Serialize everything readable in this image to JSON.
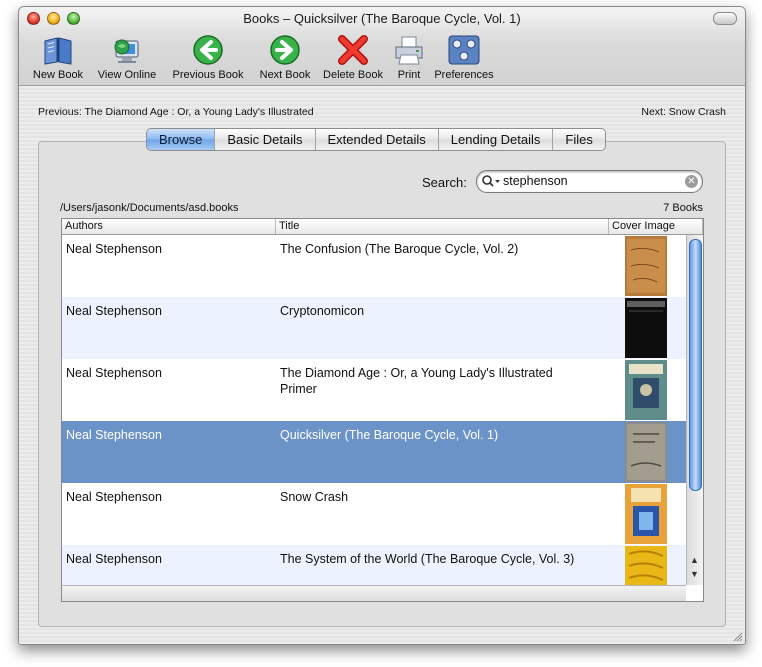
{
  "window": {
    "title": "Books – Quicksilver (The Baroque Cycle, Vol. 1)"
  },
  "toolbar": {
    "new_book": "New Book",
    "view_online": "View Online",
    "previous_book": "Previous Book",
    "next_book": "Next Book",
    "delete_book": "Delete Book",
    "print": "Print",
    "preferences": "Preferences"
  },
  "nav": {
    "previous": "Previous: The Diamond Age : Or, a Young Lady's Illustrated",
    "next": "Next: Snow Crash"
  },
  "tabs": [
    "Browse",
    "Basic Details",
    "Extended Details",
    "Lending Details",
    "Files"
  ],
  "active_tab": "Browse",
  "search": {
    "label": "Search:",
    "value": "stephenson"
  },
  "path": "/Users/jasonk/Documents/asd.books",
  "count": "7 Books",
  "table": {
    "columns": [
      "Authors",
      "Title",
      "Cover Image"
    ],
    "rows": [
      {
        "author": "Neal Stephenson",
        "title": "The Confusion (The Baroque Cycle, Vol. 2)",
        "selected": false
      },
      {
        "author": "Neal Stephenson",
        "title": "Cryptonomicon",
        "selected": false
      },
      {
        "author": "Neal Stephenson",
        "title": "The Diamond Age : Or, a Young Lady's Illustrated Primer",
        "selected": false
      },
      {
        "author": "Neal Stephenson",
        "title": "Quicksilver (The Baroque Cycle, Vol. 1)",
        "selected": true
      },
      {
        "author": "Neal Stephenson",
        "title": "Snow Crash",
        "selected": false
      },
      {
        "author": "Neal Stephenson",
        "title": "The System of the World (The Baroque Cycle, Vol. 3)",
        "selected": false
      }
    ]
  },
  "colors": {
    "selection": "#6c93c7",
    "alt_row": "#edf3fe",
    "tab_active": "#7fb0ee"
  }
}
